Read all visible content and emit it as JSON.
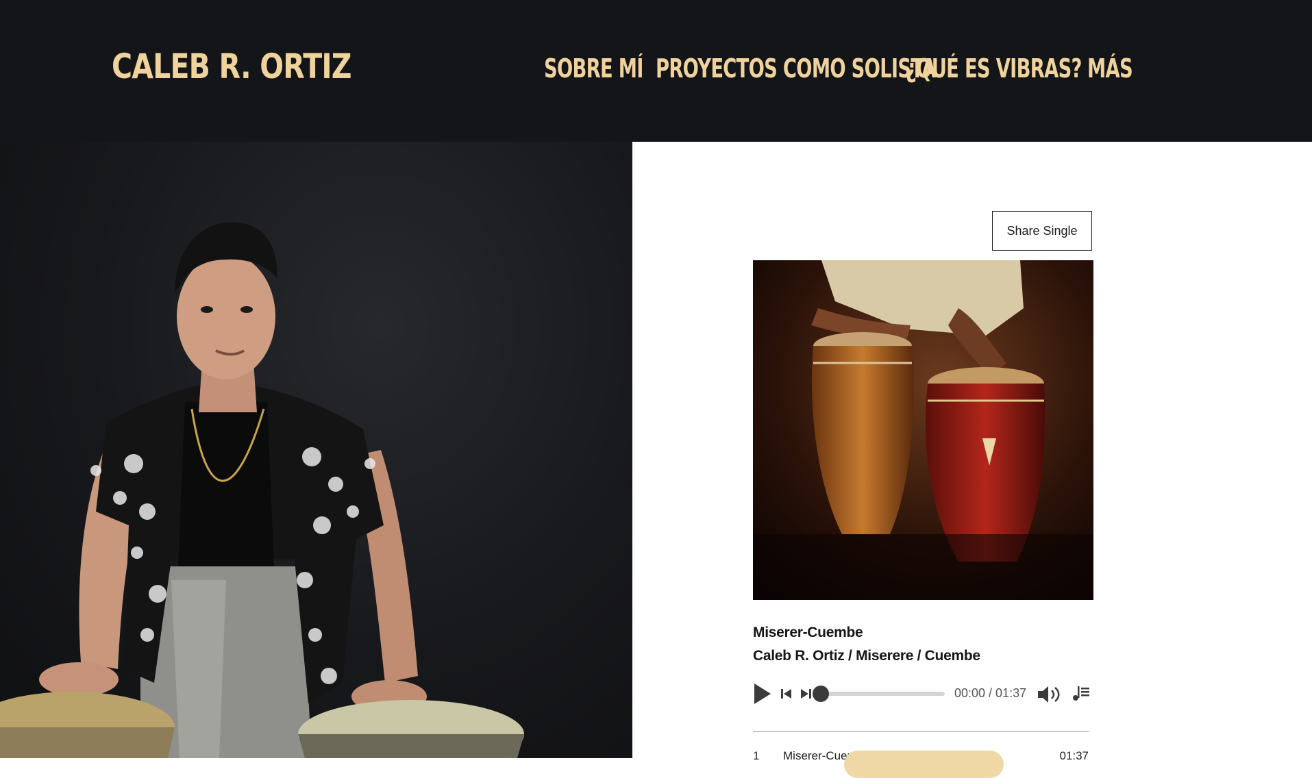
{
  "header": {
    "brand": "CALEB R. ORTIZ",
    "nav": [
      {
        "label": "SOBRE MÍ"
      },
      {
        "label": "PROYECTOS COMO SOLISTA"
      },
      {
        "label": "¿QUÉ ES VIBRAS?"
      },
      {
        "label": "MÁS"
      }
    ]
  },
  "player": {
    "share_label": "Share Single",
    "track_title": "Miserer-Cuembe",
    "track_subtitle": "Caleb R. Ortiz / Miserere / Cuembe",
    "time_display": "00:00 / 01:37",
    "progress": 0
  },
  "tracklist": [
    {
      "number": "1",
      "name": "Miserer-Cuembe",
      "duration": "01:37"
    }
  ],
  "icons": {
    "play": "play-icon",
    "previous": "skip-back-icon",
    "next": "skip-forward-icon",
    "volume": "volume-icon",
    "playlist": "playlist-icon"
  },
  "colors": {
    "header_bg": "#141518",
    "accent": "#f0d39c",
    "pill": "#efd7a6"
  }
}
